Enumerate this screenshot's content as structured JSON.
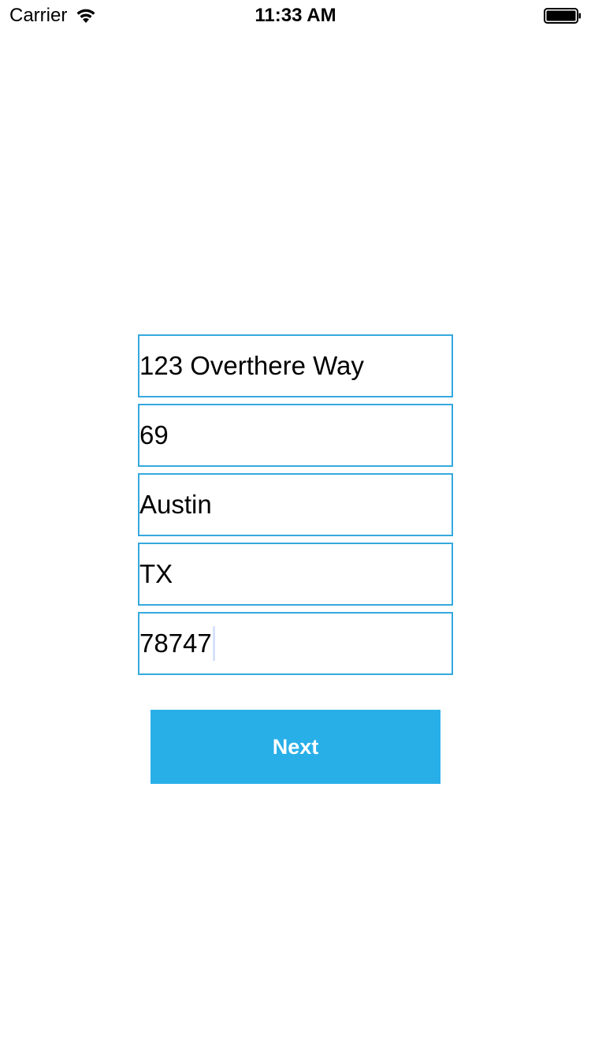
{
  "status_bar": {
    "carrier": "Carrier",
    "time": "11:33 AM",
    "wifi_icon": "wifi-icon",
    "battery_icon": "battery-icon"
  },
  "form": {
    "fields": [
      {
        "name": "street",
        "value": "123 Overthere Way"
      },
      {
        "name": "unit",
        "value": "69"
      },
      {
        "name": "city",
        "value": "Austin"
      },
      {
        "name": "state",
        "value": "TX"
      },
      {
        "name": "zip",
        "value": "78747"
      }
    ],
    "focused_field": "zip"
  },
  "next_button": {
    "label": "Next"
  },
  "colors": {
    "field_border": "#35a9dd",
    "button_background": "#29afe8",
    "button_text": "#ffffff",
    "cursor": "#d6e2fb"
  }
}
